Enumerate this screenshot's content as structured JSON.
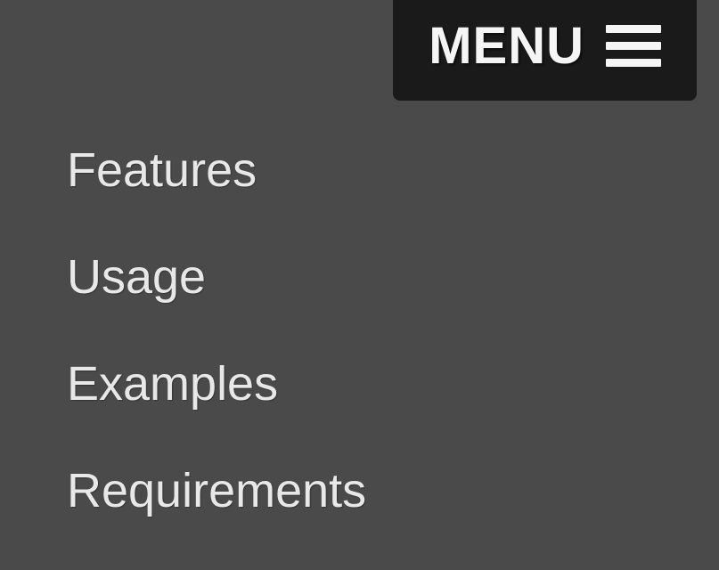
{
  "menu": {
    "label": "MENU"
  },
  "nav": {
    "items": [
      {
        "label": "Features"
      },
      {
        "label": "Usage"
      },
      {
        "label": "Examples"
      },
      {
        "label": "Requirements"
      }
    ]
  }
}
